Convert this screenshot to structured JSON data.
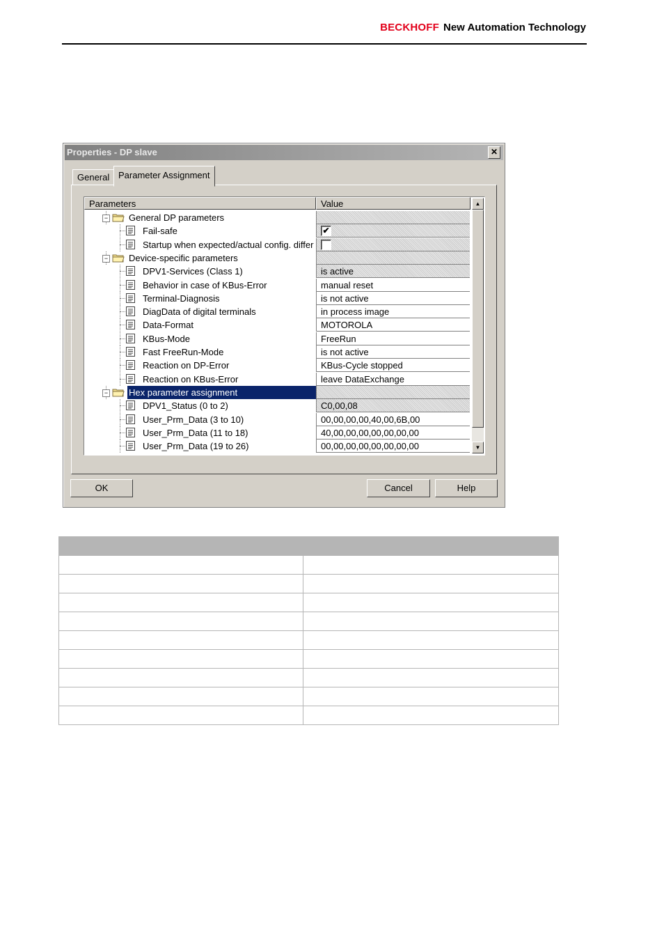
{
  "header": {
    "brand": "BECKHOFF",
    "tagline": "New Automation Technology"
  },
  "dialog": {
    "title": "Properties - DP slave",
    "close_label": "✕",
    "tabs": [
      {
        "label": "General",
        "active": false
      },
      {
        "label": "Parameter Assignment",
        "active": true
      }
    ],
    "columns": {
      "parameters": "Parameters",
      "value": "Value"
    },
    "rows": [
      {
        "level": 1,
        "kind": "folder",
        "name": "General DP parameters",
        "value": "",
        "readonly": true
      },
      {
        "level": 2,
        "kind": "param",
        "name": "Fail-safe",
        "value": "",
        "check": "✔",
        "readonly": true
      },
      {
        "level": 2,
        "kind": "param",
        "name": "Startup when expected/actual config. differ",
        "value": "",
        "check": "",
        "readonly": true
      },
      {
        "level": 1,
        "kind": "folder",
        "name": "Device-specific parameters",
        "value": "",
        "readonly": true
      },
      {
        "level": 2,
        "kind": "param",
        "name": "DPV1-Services (Class 1)",
        "value": "is active",
        "readonly": true
      },
      {
        "level": 2,
        "kind": "param",
        "name": "Behavior in case of KBus-Error",
        "value": "manual reset",
        "readonly": false
      },
      {
        "level": 2,
        "kind": "param",
        "name": "Terminal-Diagnosis",
        "value": "is not active",
        "readonly": false
      },
      {
        "level": 2,
        "kind": "param",
        "name": "DiagData of digital terminals",
        "value": "in process image",
        "readonly": false
      },
      {
        "level": 2,
        "kind": "param",
        "name": "Data-Format",
        "value": "MOTOROLA",
        "readonly": false
      },
      {
        "level": 2,
        "kind": "param",
        "name": "KBus-Mode",
        "value": "FreeRun",
        "readonly": false
      },
      {
        "level": 2,
        "kind": "param",
        "name": "Fast FreeRun-Mode",
        "value": "is not active",
        "readonly": false
      },
      {
        "level": 2,
        "kind": "param",
        "name": "Reaction on DP-Error",
        "value": "KBus-Cycle stopped",
        "readonly": false
      },
      {
        "level": 2,
        "kind": "param",
        "name": "Reaction on KBus-Error",
        "value": "leave DataExchange",
        "readonly": false
      },
      {
        "level": 1,
        "kind": "folder",
        "name": "Hex parameter assignment",
        "value": "",
        "readonly": true,
        "selected": true
      },
      {
        "level": 2,
        "kind": "param",
        "name": "DPV1_Status (0 to 2)",
        "value": "C0,00,08",
        "readonly": true
      },
      {
        "level": 2,
        "kind": "param",
        "name": "User_Prm_Data (3 to 10)",
        "value": "00,00,00,00,40,00,6B,00",
        "readonly": false
      },
      {
        "level": 2,
        "kind": "param",
        "name": "User_Prm_Data (11 to 18)",
        "value": "40,00,00,00,00,00,00,00",
        "readonly": false
      },
      {
        "level": 2,
        "kind": "param",
        "name": "User_Prm_Data (19 to 26)",
        "value": "00,00,00,00,00,00,00,00",
        "readonly": false
      }
    ],
    "scroll_up": "▲",
    "scroll_down": "▼",
    "buttons": {
      "ok": "OK",
      "cancel": "Cancel",
      "help": "Help"
    }
  },
  "lower_table": {
    "header": [
      "",
      ""
    ],
    "rows": [
      [
        "",
        ""
      ],
      [
        "",
        ""
      ],
      [
        "",
        ""
      ],
      [
        "",
        ""
      ],
      [
        "",
        ""
      ],
      [
        "",
        ""
      ],
      [
        "",
        ""
      ],
      [
        "",
        ""
      ],
      [
        "",
        ""
      ]
    ]
  },
  "colors": {
    "brand_red": "#e2001a",
    "selection": "#0a246a",
    "dialog_face": "#d4d0c8"
  }
}
